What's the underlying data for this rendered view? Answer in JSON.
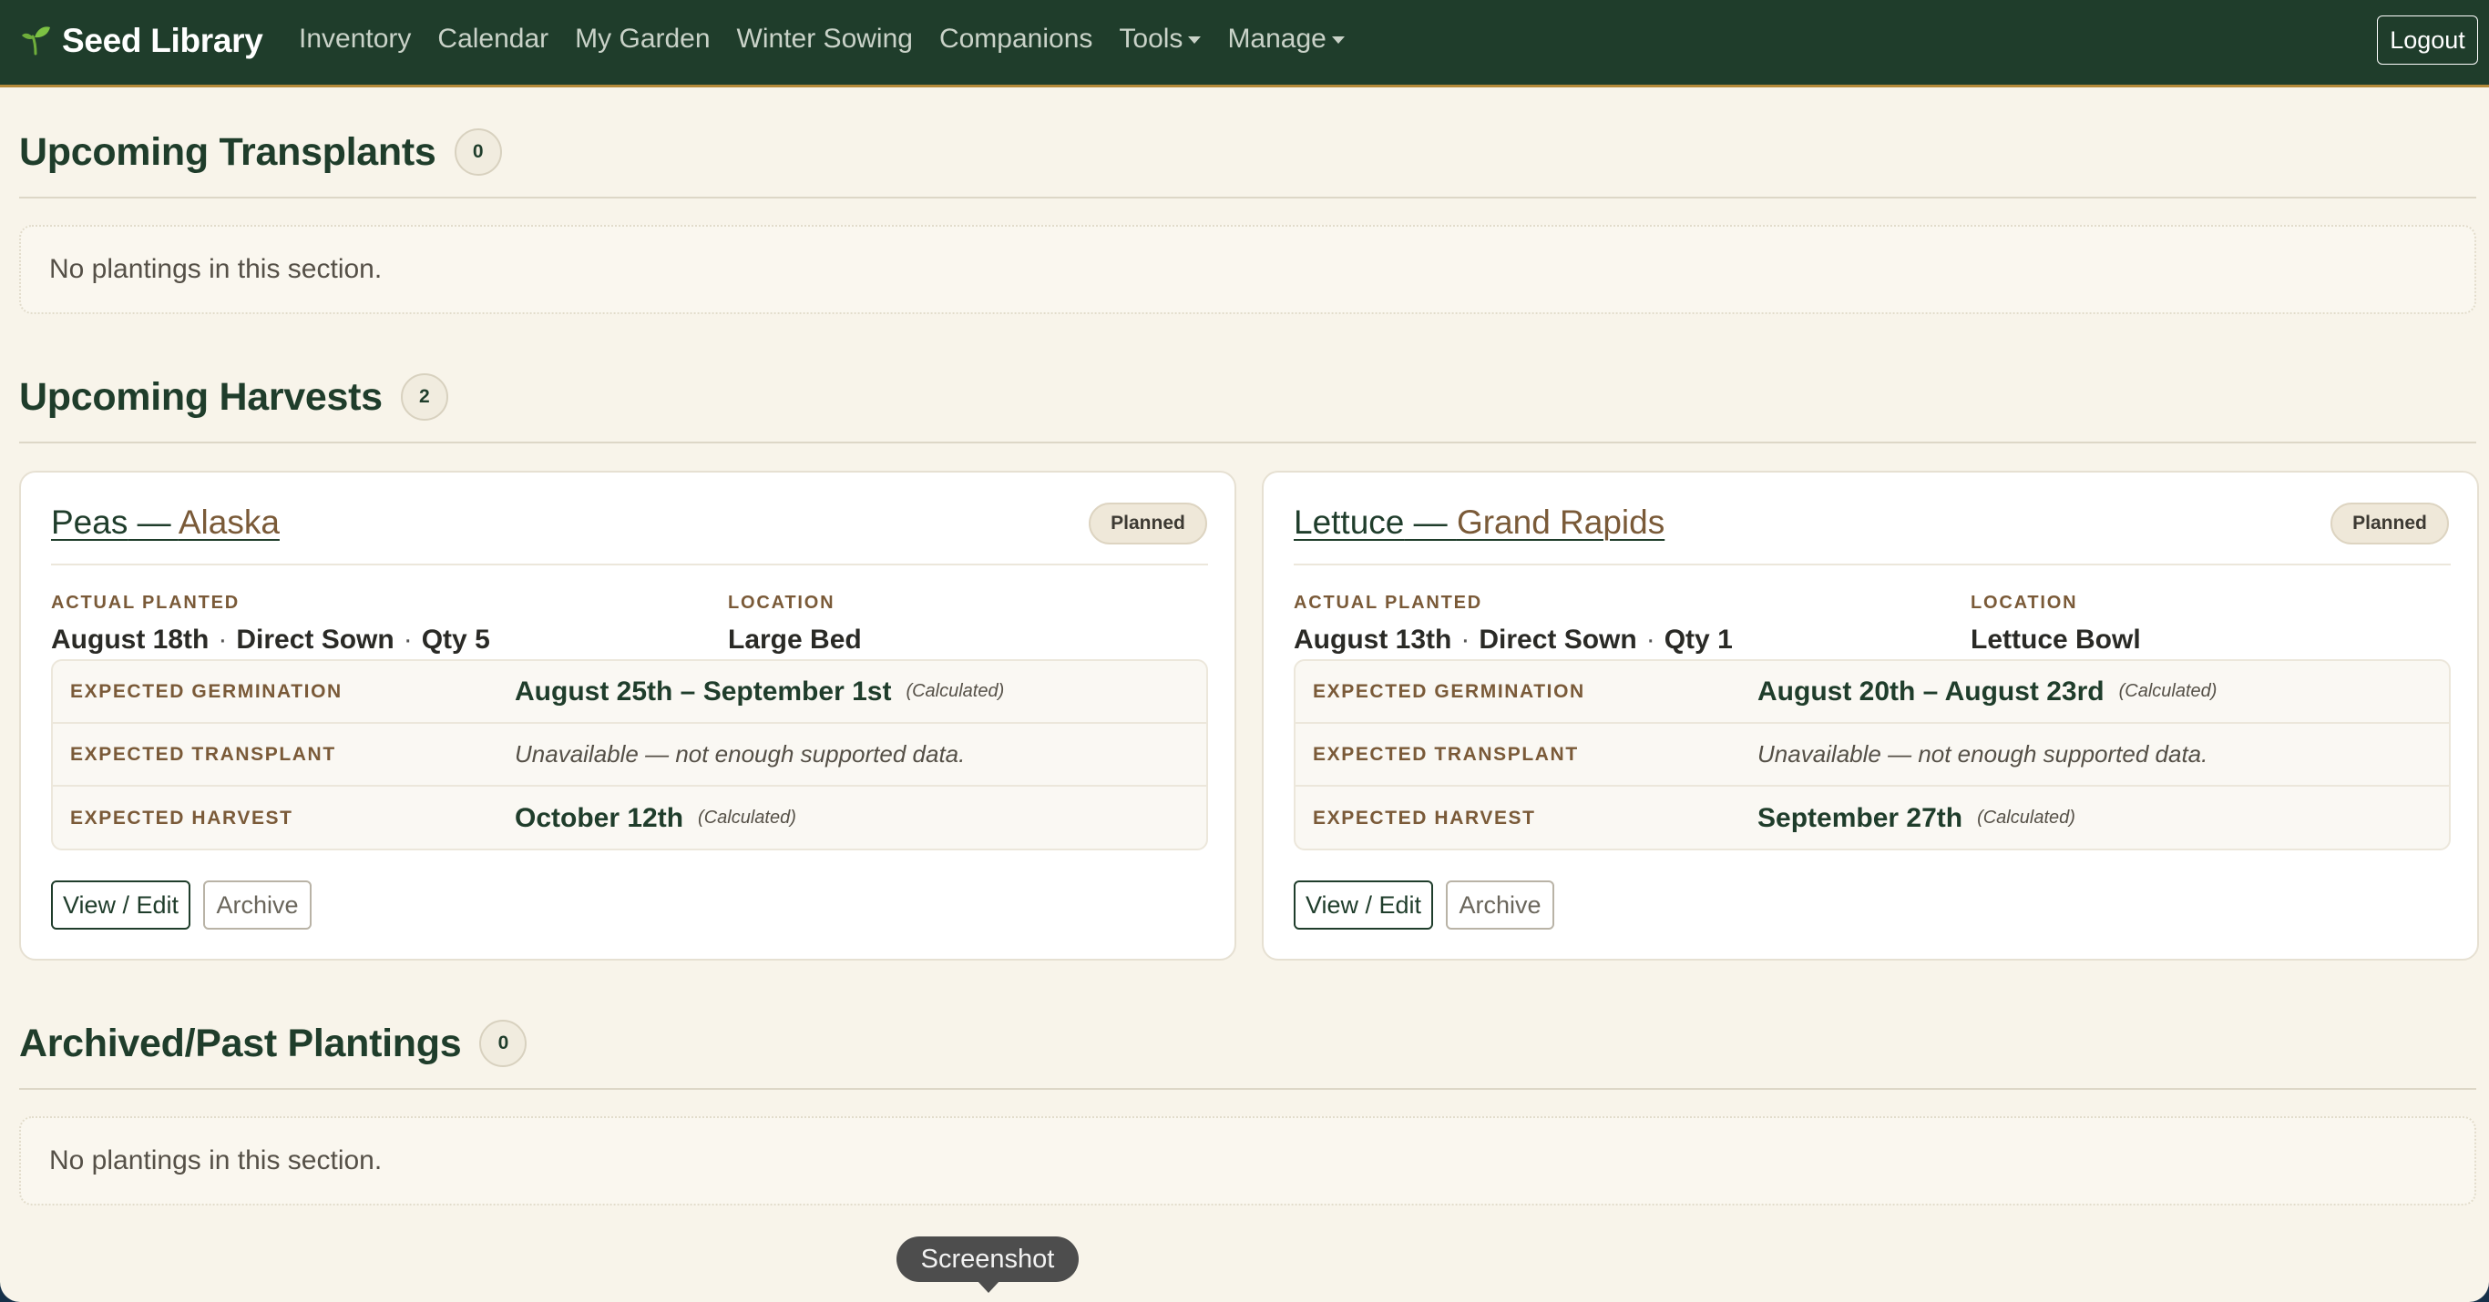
{
  "navbar": {
    "brand": "Seed Library",
    "brand_icon": "sprout-icon",
    "links": [
      "Inventory",
      "Calendar",
      "My Garden",
      "Winter Sowing",
      "Companions",
      "Tools",
      "Manage"
    ],
    "logout_label": "Logout"
  },
  "colors": {
    "nav_bg": "#1f3d2b",
    "page_bg": "#f8f4ea",
    "accent_brown": "#7a5a38",
    "nav_underline": "#b58a3a"
  },
  "sections": {
    "transplants": {
      "title": "Upcoming Transplants",
      "count": "0",
      "empty_text": "No plantings in this section."
    },
    "harvests": {
      "title": "Upcoming Harvests",
      "count": "2"
    },
    "archived": {
      "title": "Archived/Past Plantings",
      "count": "0",
      "empty_text": "No plantings in this section."
    }
  },
  "cards": [
    {
      "crop": "Peas",
      "separator": " — ",
      "variety": "Alaska",
      "status": "Planned",
      "actual_planted_label": "ACTUAL PLANTED",
      "planted_date": "August 18th",
      "method": "Direct Sown",
      "qty": "Qty 5",
      "location_label": "LOCATION",
      "location": "Large Bed",
      "germination_label": "EXPECTED GERMINATION",
      "germination": "August 25th – September 1st",
      "germination_note": "(Calculated)",
      "transplant_label": "EXPECTED TRANSPLANT",
      "transplant": "Unavailable — not enough supported data.",
      "harvest_label": "EXPECTED HARVEST",
      "harvest": "October 12th",
      "harvest_note": "(Calculated)",
      "edit_label": "View / Edit",
      "archive_label": "Archive"
    },
    {
      "crop": "Lettuce",
      "separator": " — ",
      "variety": "Grand Rapids",
      "status": "Planned",
      "actual_planted_label": "ACTUAL PLANTED",
      "planted_date": "August 13th",
      "method": "Direct Sown",
      "qty": "Qty 1",
      "location_label": "LOCATION",
      "location": "Lettuce Bowl",
      "germination_label": "EXPECTED GERMINATION",
      "germination": "August 20th – August 23rd",
      "germination_note": "(Calculated)",
      "transplant_label": "EXPECTED TRANSPLANT",
      "transplant": "Unavailable — not enough supported data.",
      "harvest_label": "EXPECTED HARVEST",
      "harvest": "September 27th",
      "harvest_note": "(Calculated)",
      "edit_label": "View / Edit",
      "archive_label": "Archive"
    }
  ],
  "tooltip": {
    "label": "Screenshot"
  }
}
